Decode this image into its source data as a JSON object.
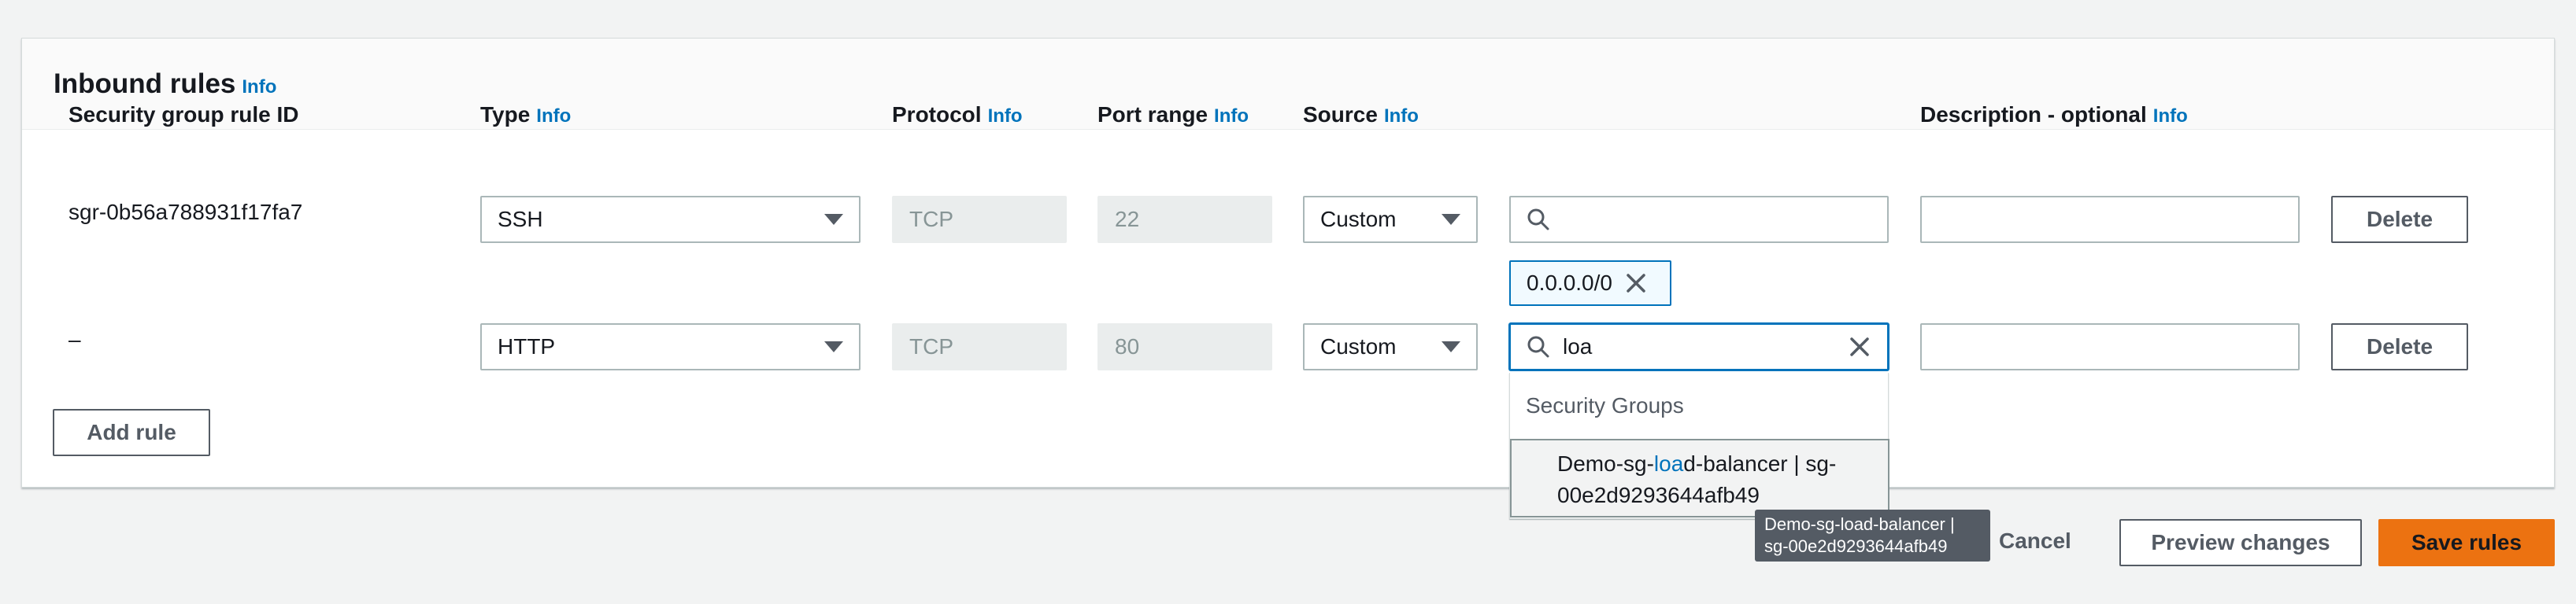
{
  "panel": {
    "title": "Inbound rules",
    "title_info": "Info"
  },
  "columns": {
    "rule_id": "Security group rule ID",
    "type": "Type",
    "type_info": "Info",
    "protocol": "Protocol",
    "protocol_info": "Info",
    "port_range": "Port range",
    "port_range_info": "Info",
    "source": "Source",
    "source_info": "Info",
    "description": "Description - optional",
    "description_info": "Info"
  },
  "rules": [
    {
      "rule_id": "sgr-0b56a788931f17fa7",
      "type": "SSH",
      "protocol": "TCP",
      "port_range": "22",
      "source_type": "Custom",
      "source_search": "",
      "source_token": "0.0.0.0/0",
      "description": "",
      "delete_label": "Delete"
    },
    {
      "rule_id": "–",
      "type": "HTTP",
      "protocol": "TCP",
      "port_range": "80",
      "source_type": "Custom",
      "source_search": "loa",
      "description": "",
      "delete_label": "Delete"
    }
  ],
  "add_rule_label": "Add rule",
  "dropdown": {
    "group_label": "Security Groups",
    "option_prefix": "Demo-sg-",
    "option_match": "loa",
    "option_suffix_line1": "d-balancer | sg-",
    "option_line2": "00e2d9293644afb49"
  },
  "tooltip": {
    "line1": "Demo-sg-load-balancer |",
    "line2": "sg-00e2d9293644afb49"
  },
  "footer": {
    "cancel": "Cancel",
    "preview": "Preview changes",
    "save": "Save rules"
  },
  "colors": {
    "accent": "#0073bb",
    "primary_button": "#ec7211",
    "background": "#f2f3f3"
  }
}
